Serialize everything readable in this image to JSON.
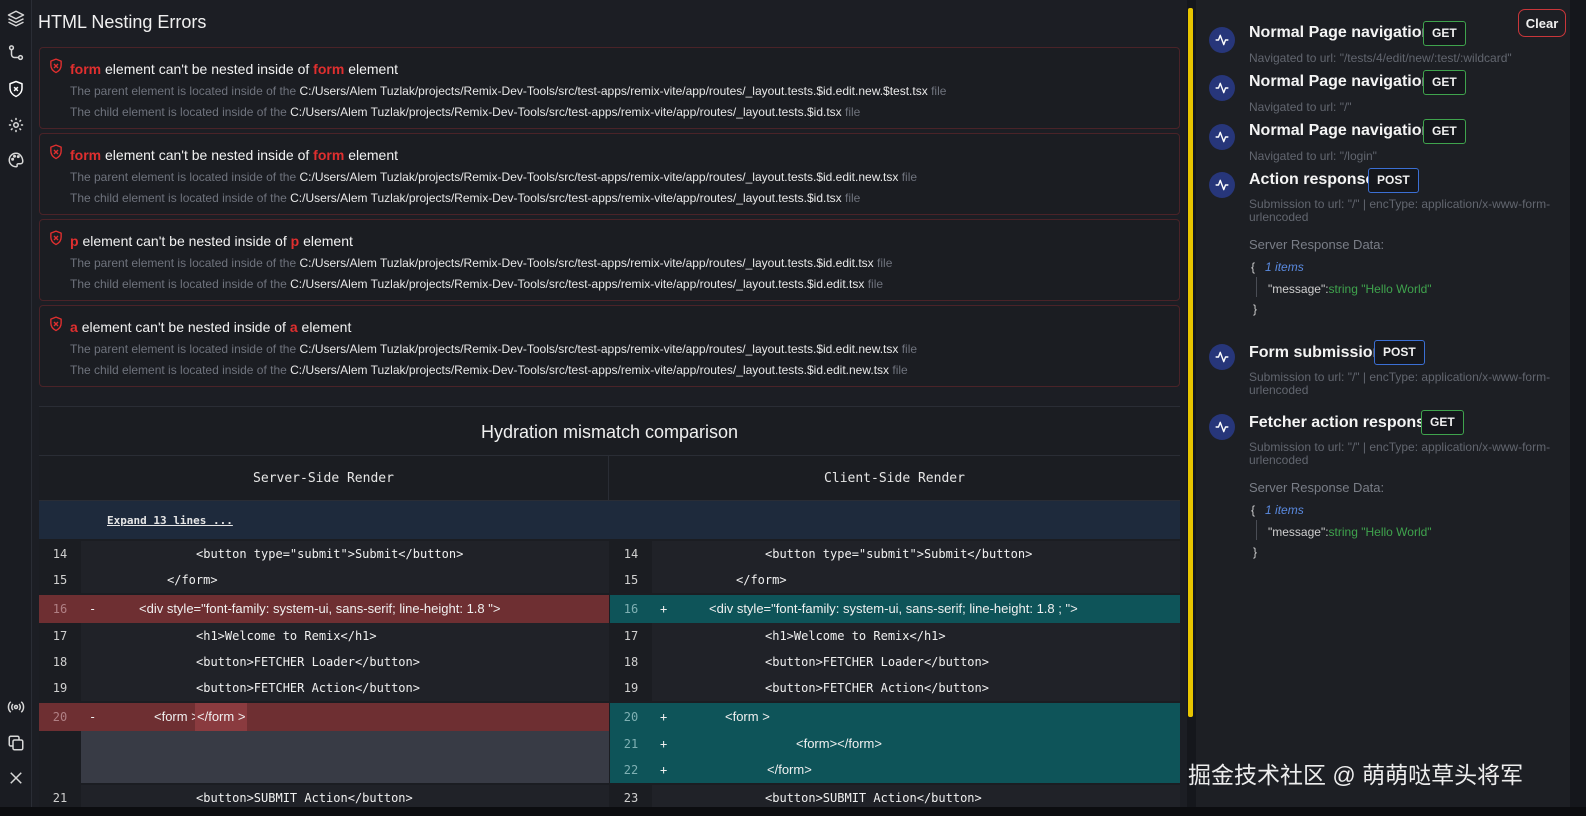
{
  "nesting": {
    "title": "HTML Nesting Errors",
    "errors": [
      {
        "tag": "form",
        "msg_mid": "element can't be nested inside of",
        "parent_tag": "form",
        "msg_end": "element",
        "parent_prefix": "The parent element is located inside of the",
        "parent_path": "C:/Users/Alem Tuzlak/projects/Remix-Dev-Tools/src/test-apps/remix-vite/app/routes/_layout.tests.$id.edit.new.$test.tsx",
        "child_prefix": "The child element is located inside of the",
        "child_path": "C:/Users/Alem Tuzlak/projects/Remix-Dev-Tools/src/test-apps/remix-vite/app/routes/_layout.tests.$id.tsx",
        "suffix": "file"
      },
      {
        "tag": "form",
        "msg_mid": "element can't be nested inside of",
        "parent_tag": "form",
        "msg_end": "element",
        "parent_prefix": "The parent element is located inside of the",
        "parent_path": "C:/Users/Alem Tuzlak/projects/Remix-Dev-Tools/src/test-apps/remix-vite/app/routes/_layout.tests.$id.edit.new.tsx",
        "child_prefix": "The child element is located inside of the",
        "child_path": "C:/Users/Alem Tuzlak/projects/Remix-Dev-Tools/src/test-apps/remix-vite/app/routes/_layout.tests.$id.tsx",
        "suffix": "file"
      },
      {
        "tag": "p",
        "msg_mid": "element can't be nested inside of",
        "parent_tag": "p",
        "msg_end": "element",
        "parent_prefix": "The parent element is located inside of the",
        "parent_path": "C:/Users/Alem Tuzlak/projects/Remix-Dev-Tools/src/test-apps/remix-vite/app/routes/_layout.tests.$id.edit.tsx",
        "child_prefix": "The child element is located inside of the",
        "child_path": "C:/Users/Alem Tuzlak/projects/Remix-Dev-Tools/src/test-apps/remix-vite/app/routes/_layout.tests.$id.edit.tsx",
        "suffix": "file"
      },
      {
        "tag": "a",
        "msg_mid": "element can't be nested inside of",
        "parent_tag": "a",
        "msg_end": "element",
        "parent_prefix": "The parent element is located inside of the",
        "parent_path": "C:/Users/Alem Tuzlak/projects/Remix-Dev-Tools/src/test-apps/remix-vite/app/routes/_layout.tests.$id.edit.new.tsx",
        "child_prefix": "The child element is located inside of the",
        "child_path": "C:/Users/Alem Tuzlak/projects/Remix-Dev-Tools/src/test-apps/remix-vite/app/routes/_layout.tests.$id.edit.new.tsx",
        "suffix": "file"
      }
    ]
  },
  "hydration": {
    "title": "Hydration mismatch comparison",
    "server_header": "Server-Side Render",
    "client_header": "Client-Side Render",
    "expand_label": "Expand 13 lines ...",
    "server": {
      "l14": {
        "num": "14",
        "code": "<button type=\"submit\">Submit</button>"
      },
      "l15": {
        "num": "15",
        "code": "</form>"
      },
      "l16": {
        "num": "16",
        "mark": "-",
        "code": "<div style=\"font-family: system-ui, sans-serif; line-height: 1.8 \">"
      },
      "l17": {
        "num": "17",
        "code": "<h1>Welcome to Remix</h1>"
      },
      "l18": {
        "num": "18",
        "code": "<button>FETCHER Loader</button>"
      },
      "l19": {
        "num": "19",
        "code": "<button>FETCHER Action</button>"
      },
      "l20": {
        "num": "20",
        "mark": "-",
        "code_a": "<form >",
        "code_b": "</form >"
      },
      "l21": {
        "num": "21",
        "code": "<button>SUBMIT Action</button>"
      }
    },
    "client": {
      "l14": {
        "num": "14",
        "code": "<button type=\"submit\">Submit</button>"
      },
      "l15": {
        "num": "15",
        "code": "</form>"
      },
      "l16": {
        "num": "16",
        "mark": "+",
        "code": "<div style=\"font-family:  system-ui, sans-serif;  line-height:  1.8 ; \">"
      },
      "l17": {
        "num": "17",
        "code": "<h1>Welcome to Remix</h1>"
      },
      "l18": {
        "num": "18",
        "code": "<button>FETCHER Loader</button>"
      },
      "l19": {
        "num": "19",
        "code": "<button>FETCHER Action</button>"
      },
      "l20": {
        "num": "20",
        "mark": "+",
        "code": "<form >"
      },
      "l21": {
        "num": "21",
        "mark": "+",
        "code": "<form></form>"
      },
      "l22": {
        "num": "22",
        "mark": "+",
        "code": "</form>"
      },
      "l23": {
        "num": "23",
        "code": "<button>SUBMIT Action</button>"
      }
    }
  },
  "timeline": {
    "clear_label": "Clear",
    "events": [
      {
        "title": "Normal Page navigation",
        "method": "GET",
        "sub": "Navigated to url: \"/tests/4/edit/new/:test/:wildcard\""
      },
      {
        "title": "Normal Page navigation",
        "method": "GET",
        "sub": "Navigated to url: \"/\""
      },
      {
        "title": "Normal Page navigation",
        "method": "GET",
        "sub": "Navigated to url: \"/login\""
      },
      {
        "title": "Action response",
        "method": "POST",
        "sub": "Submission to url: \"/\" | encType: application/x-www-form-urlencoded",
        "data_label": "Server Response Data:",
        "count": "1 items",
        "key": "\"message\":",
        "type": "string",
        "value": "\"Hello World\""
      },
      {
        "title": "Form submission",
        "method": "POST",
        "sub": "Submission to url: \"/\" | encType: application/x-www-form-urlencoded"
      },
      {
        "title": "Fetcher action response",
        "method": "GET",
        "sub": "Submission to url: \"/\" | encType: application/x-www-form-urlencoded",
        "data_label": "Server Response Data:",
        "count": "1 items",
        "key": "\"message\":",
        "type": "string",
        "value": "\"Hello World\""
      }
    ]
  },
  "json_braces": {
    "open": "{",
    "close": "}"
  },
  "watermark": "掘金技术社区 @ 萌萌哒草头将军",
  "sidebar_icons": [
    "layers-icon",
    "git-branch-icon",
    "shield-error-icon",
    "gear-icon",
    "palette-icon",
    "broadcast-icon",
    "copy-icon",
    "close-icon"
  ],
  "colors": {
    "accent_yellow": "#e8c500",
    "error_red": "#e02f2f",
    "get_green": "#3fa34d",
    "post_blue": "#3b6fd4",
    "diff_removed": "#6e2f32",
    "diff_added": "#0e5459"
  }
}
